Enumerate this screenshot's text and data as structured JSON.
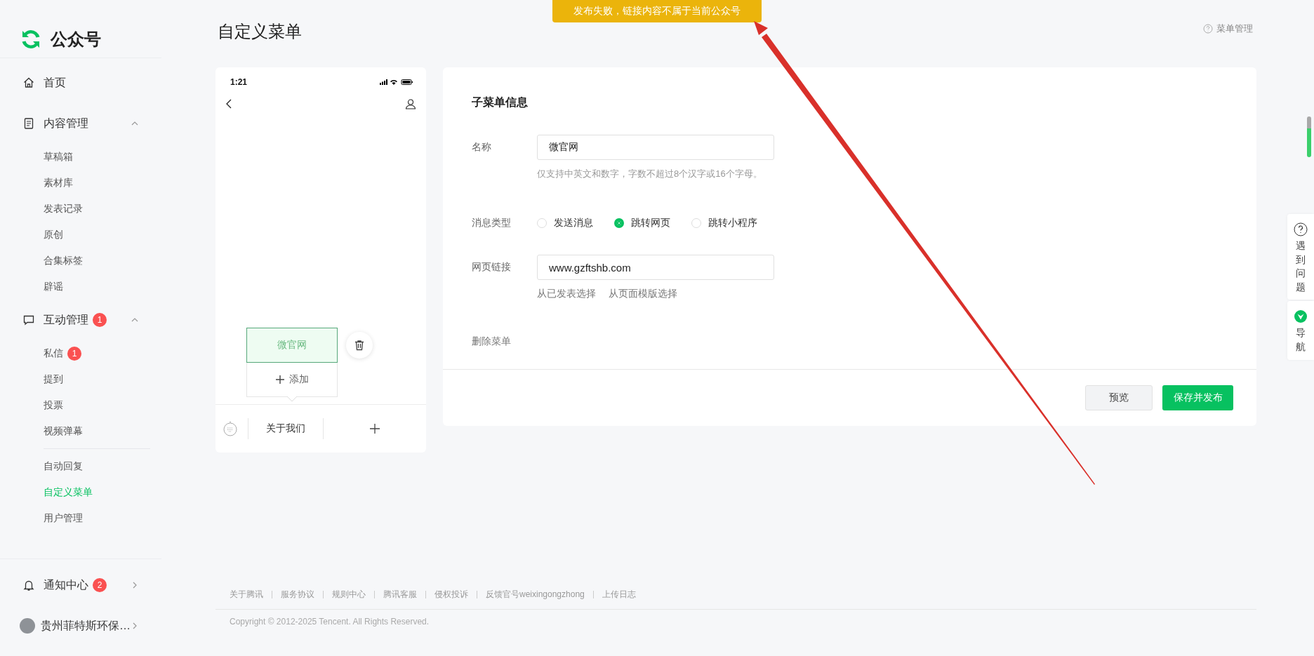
{
  "toast": {
    "text": "发布失败，链接内容不属于当前公众号"
  },
  "sidebar": {
    "logo": "公众号",
    "items": [
      {
        "label": "首页",
        "kind": "home"
      },
      {
        "label": "内容管理",
        "kind": "doc",
        "expanded": true,
        "groups": [
          [
            {
              "label": "草稿箱",
              "selected": false
            },
            {
              "label": "素材库",
              "selected": false
            },
            {
              "label": "发表记录",
              "selected": false
            },
            {
              "label": "原创",
              "selected": false
            },
            {
              "label": "合集标签",
              "selected": false
            },
            {
              "label": "辟谣",
              "selected": false
            }
          ]
        ]
      },
      {
        "label": "互动管理",
        "kind": "chat",
        "badge": "1",
        "expanded": true,
        "groups": [
          [
            {
              "label": "私信",
              "badge": "1",
              "selected": false
            },
            {
              "label": "提到",
              "selected": false
            },
            {
              "label": "投票",
              "selected": false
            },
            {
              "label": "视频弹幕",
              "selected": false
            }
          ],
          [
            {
              "label": "自动回复",
              "selected": false
            },
            {
              "label": "自定义菜单",
              "selected": true
            },
            {
              "label": "用户管理",
              "selected": false
            }
          ]
        ]
      }
    ],
    "bottom": [
      {
        "label": "通知中心",
        "kind": "bell",
        "badge": "2"
      },
      {
        "label": "贵州菲特斯环保…",
        "kind": "avatar"
      }
    ]
  },
  "page": {
    "title": "自定义菜单",
    "help_link": "菜单管理"
  },
  "phone": {
    "time": "1:21",
    "submenu": [
      {
        "label": "微官网",
        "selected": true
      }
    ],
    "add_label": "添加",
    "menu": [
      {
        "label": "关于我们"
      }
    ]
  },
  "form": {
    "heading": "子菜单信息",
    "name": {
      "label": "名称",
      "value": "微官网",
      "hint": "仅支持中英文和数字，字数不超过8个汉字或16个字母。"
    },
    "message_type": {
      "label": "消息类型",
      "options": [
        {
          "label": "发送消息",
          "selected": false
        },
        {
          "label": "跳转网页",
          "selected": true
        },
        {
          "label": "跳转小程序",
          "selected": false
        }
      ]
    },
    "url": {
      "label": "网页链接",
      "value": "www.gzftshb.com",
      "links": [
        "从已发表选择",
        "从页面模版选择"
      ]
    },
    "delete": "删除菜单",
    "buttons": [
      {
        "label": "预览",
        "kind": "secondary"
      },
      {
        "label": "保存并发布",
        "kind": "primary"
      }
    ]
  },
  "footer": {
    "links": [
      "关于腾讯",
      "服务协议",
      "规则中心",
      "腾讯客服",
      "侵权投诉",
      "反馈官号weixingongzhong",
      "上传日志"
    ],
    "copyright": "Copyright © 2012-2025 Tencent. All Rights Reserved."
  },
  "float": {
    "help": "遇到问题",
    "nav": "导航"
  }
}
